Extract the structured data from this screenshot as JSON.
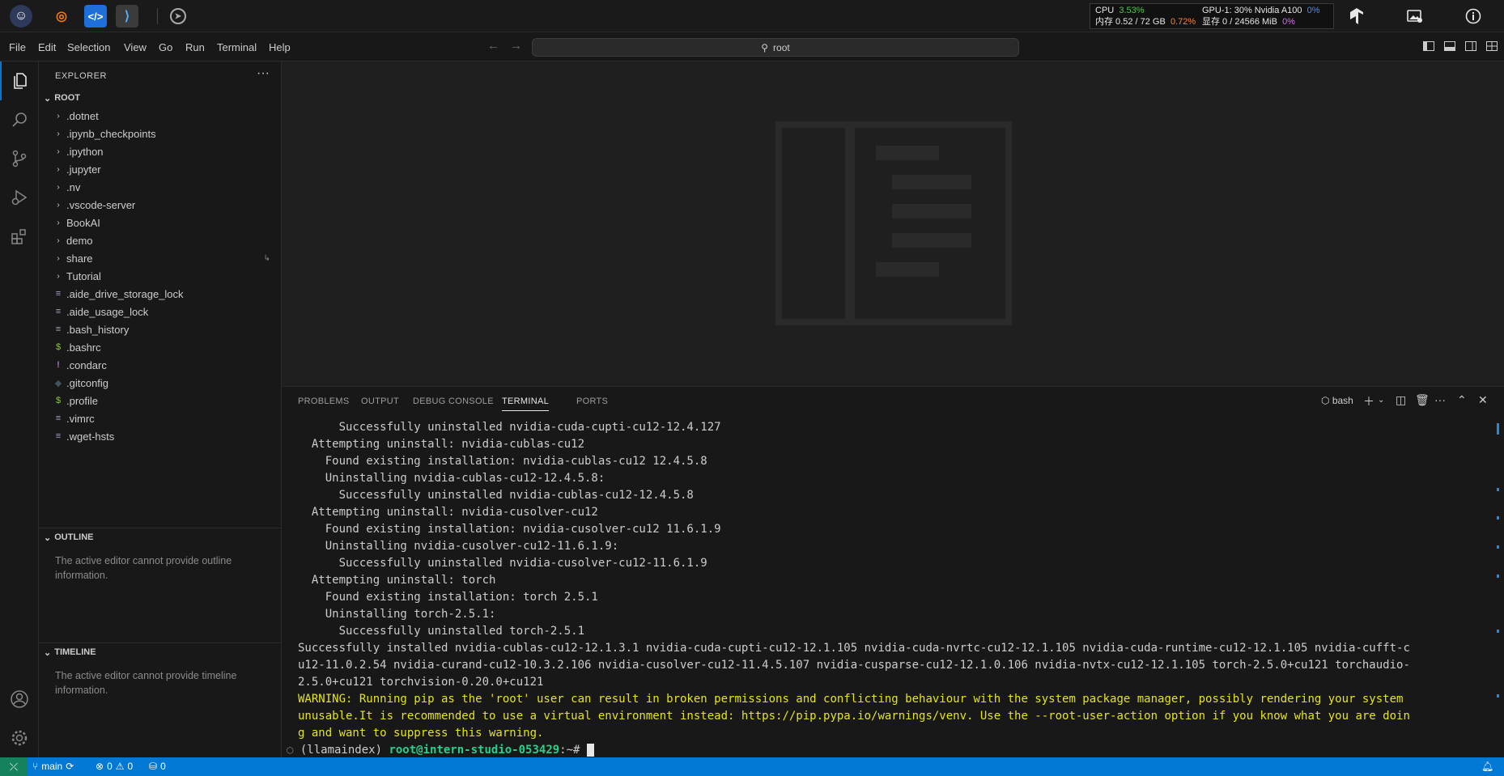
{
  "topbar": {
    "stats": {
      "cpu_label": "CPU",
      "cpu_value": "3.53%",
      "gpu_label": "GPU-1: 30% Nvidia A100",
      "gpu_value": "0%",
      "mem_label": "内存 0.52 / 72 GB",
      "mem_value": "0.72%",
      "vram_label": "显存 0 / 24566 MiB",
      "vram_value": "0%"
    },
    "apps": [
      "app-logo-icon",
      "jupyter-icon",
      "vscode-web-icon",
      "vscode-icon",
      "compass-icon"
    ]
  },
  "menubar": {
    "items": [
      "File",
      "Edit",
      "Selection",
      "View",
      "Go",
      "Run",
      "Terminal",
      "Help"
    ],
    "search_text": "root"
  },
  "sidebar": {
    "title": "EXPLORER",
    "root_label": "ROOT",
    "folders": [
      ".dotnet",
      ".ipynb_checkpoints",
      ".ipython",
      ".jupyter",
      ".nv",
      ".vscode-server",
      "BookAI",
      "demo",
      "share",
      "Tutorial"
    ],
    "files": [
      {
        "name": ".aide_drive_storage_lock",
        "icon": "≡"
      },
      {
        "name": ".aide_usage_lock",
        "icon": "≡"
      },
      {
        "name": ".bash_history",
        "icon": "≡"
      },
      {
        "name": ".bashrc",
        "icon": "$"
      },
      {
        "name": ".condarc",
        "icon": "!"
      },
      {
        "name": ".gitconfig",
        "icon": "◆"
      },
      {
        "name": ".profile",
        "icon": "$"
      },
      {
        "name": ".vimrc",
        "icon": "≡"
      },
      {
        "name": ".wget-hsts",
        "icon": "≡"
      }
    ],
    "outline_title": "OUTLINE",
    "outline_text": "The active editor cannot provide outline information.",
    "timeline_title": "TIMELINE",
    "timeline_text": "The active editor cannot provide timeline information."
  },
  "panel": {
    "tabs": [
      "PROBLEMS",
      "OUTPUT",
      "DEBUG CONSOLE",
      "TERMINAL",
      "PORTS"
    ],
    "shell": "bash"
  },
  "terminal": {
    "lines": [
      "      Successfully uninstalled nvidia-cuda-cupti-cu12-12.4.127",
      "  Attempting uninstall: nvidia-cublas-cu12",
      "    Found existing installation: nvidia-cublas-cu12 12.4.5.8",
      "    Uninstalling nvidia-cublas-cu12-12.4.5.8:",
      "      Successfully uninstalled nvidia-cublas-cu12-12.4.5.8",
      "  Attempting uninstall: nvidia-cusolver-cu12",
      "    Found existing installation: nvidia-cusolver-cu12 11.6.1.9",
      "    Uninstalling nvidia-cusolver-cu12-11.6.1.9:",
      "      Successfully uninstalled nvidia-cusolver-cu12-11.6.1.9",
      "  Attempting uninstall: torch",
      "    Found existing installation: torch 2.5.1",
      "    Uninstalling torch-2.5.1:",
      "      Successfully uninstalled torch-2.5.1",
      "Successfully installed nvidia-cublas-cu12-12.1.3.1 nvidia-cuda-cupti-cu12-12.1.105 nvidia-cuda-nvrtc-cu12-12.1.105 nvidia-cuda-runtime-cu12-12.1.105 nvidia-cufft-c",
      "u12-11.0.2.54 nvidia-curand-cu12-10.3.2.106 nvidia-cusolver-cu12-11.4.5.107 nvidia-cusparse-cu12-12.1.0.106 nvidia-nvtx-cu12-12.1.105 torch-2.5.0+cu121 torchaudio-",
      "2.5.0+cu121 torchvision-0.20.0+cu121"
    ],
    "warning_lines": [
      "WARNING: Running pip as the 'root' user can result in broken permissions and conflicting behaviour with the system package manager, possibly rendering your system",
      "unusable.It is recommended to use a virtual environment instead: https://pip.pypa.io/warnings/venv. Use the --root-user-action option if you know what you are doin",
      "g and want to suppress this warning."
    ],
    "prompt_env": "(llamaindex)",
    "prompt_user": "root@intern-studio-053429",
    "prompt_path": ":~#"
  },
  "statusbar": {
    "branch": "main",
    "errors": "0",
    "warnings": "0",
    "ports": "0"
  },
  "colors": {
    "accent": "#0078d4",
    "remote": "#16825d",
    "warning_text": "#e5e510",
    "prompt_user": "#23d18b"
  }
}
